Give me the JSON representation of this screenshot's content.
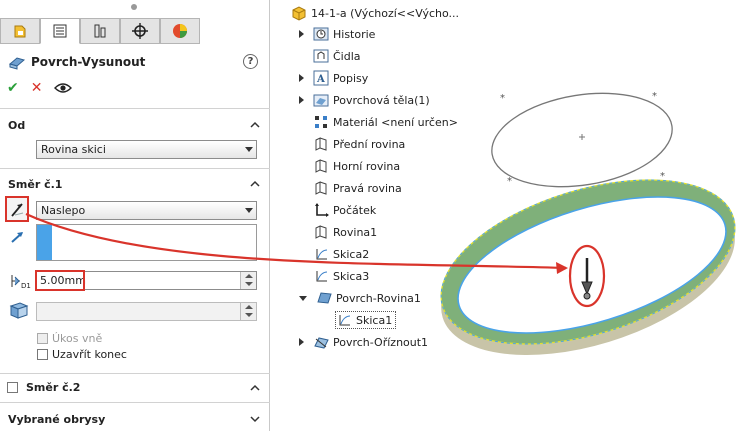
{
  "panel": {
    "title": "Povrch-Vysunout",
    "help": "?",
    "section_from": {
      "label": "Od",
      "option": "Rovina skici"
    },
    "section_dir1": {
      "label": "Směr č.1",
      "end_condition": "Naslepo",
      "depth": "5.00mm",
      "draft_outward": "Úkos vně",
      "cap_end": "Uzavřít konec"
    },
    "section_dir2": {
      "label": "Směr č.2"
    },
    "section_contours": {
      "label": "Vybrané obrysy"
    }
  },
  "tree": {
    "root": "14-1-a  (Výchozí<<Výcho...",
    "items": [
      "Historie",
      "Čidla",
      "Popisy",
      "Povrchová těla(1)",
      "Materiál <není určen>",
      "Přední rovina",
      "Horní rovina",
      "Pravá rovina",
      "Počátek",
      "Rovina1",
      "Skica2",
      "Skica3",
      "Povrch-Rovina1",
      "Skica1",
      "Povrch-Oříznout1"
    ]
  },
  "colors": {
    "accent": "#d9342b",
    "surface": "#7fb07a",
    "edge": "#e0e030",
    "rim": "#c8c4a8"
  }
}
